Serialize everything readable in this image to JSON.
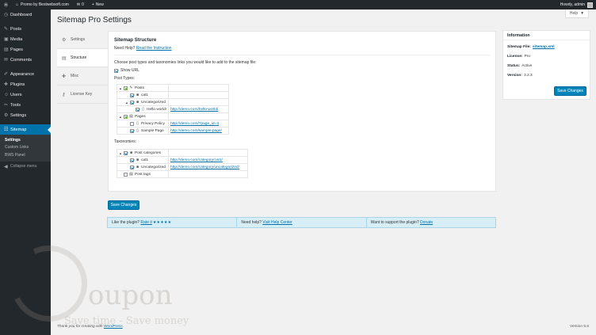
{
  "adminbar": {
    "site_name": "Promo by Bestwebsoft.com",
    "comments_count": "0",
    "new_label": "New",
    "howdy": "Howdy, admin"
  },
  "sidebar": {
    "items": [
      {
        "label": "Dashboard",
        "icon": "dashboard-icon",
        "glyph": "◷"
      },
      {
        "label": "Posts",
        "icon": "pushpin-icon",
        "glyph": "✎"
      },
      {
        "label": "Media",
        "icon": "media-icon",
        "glyph": "▣"
      },
      {
        "label": "Pages",
        "icon": "pages-icon",
        "glyph": "▤"
      },
      {
        "label": "Comments",
        "icon": "comments-icon",
        "glyph": "✉"
      },
      {
        "label": "Appearance",
        "icon": "brush-icon",
        "glyph": "✐"
      },
      {
        "label": "Plugins",
        "icon": "plugin-icon",
        "glyph": "✚"
      },
      {
        "label": "Users",
        "icon": "users-icon",
        "glyph": "☺"
      },
      {
        "label": "Tools",
        "icon": "wrench-icon",
        "glyph": "✂"
      },
      {
        "label": "Settings",
        "icon": "settings-icon",
        "glyph": "⚙"
      },
      {
        "label": "Sitemap",
        "icon": "sitemap-icon",
        "glyph": "☷"
      }
    ],
    "submenu": [
      "Settings",
      "Custom Links",
      "BWS Panel"
    ],
    "collapse_label": "Collapse menu"
  },
  "page": {
    "title": "Sitemap Pro Settings",
    "help_label": "Help"
  },
  "tabs": [
    {
      "label": "Settings",
      "icon": "gear-icon",
      "glyph": "⚙"
    },
    {
      "label": "Structure",
      "icon": "document-icon",
      "glyph": "▤"
    },
    {
      "label": "Misc",
      "icon": "misc-icon",
      "glyph": "✚"
    },
    {
      "label": "License Key",
      "icon": "key-icon",
      "glyph": "⚷"
    }
  ],
  "structure": {
    "title": "Sitemap Structure",
    "need_help": "Need Help?",
    "instruction_link": "Read the Instruction",
    "intro": "Choose post types and taxonomies links you would like to add to the sitemap file:",
    "show_url": "Show URL",
    "post_types_label": "Post Types:",
    "taxonomies_label": "Taxonomies:",
    "post_tree": [
      {
        "label": "Posts",
        "level": 0,
        "state": "partial",
        "toggle": "▲",
        "icon": "pushpin-icon",
        "glyph": "✎",
        "url": ""
      },
      {
        "label": "cat1",
        "level": 1,
        "state": "checked",
        "toggle": "",
        "icon": "folder-icon",
        "glyph": "■",
        "url": ""
      },
      {
        "label": "Uncategorized",
        "level": 1,
        "state": "checked",
        "toggle": "▲",
        "icon": "folder-icon",
        "glyph": "■",
        "url": ""
      },
      {
        "label": "Hello world!",
        "level": 2,
        "state": "checked",
        "toggle": "",
        "icon": "file-icon",
        "glyph": "▯",
        "url": "http://demo.com/hello-world/"
      },
      {
        "label": "Pages",
        "level": 0,
        "state": "partial",
        "toggle": "▲",
        "icon": "pages-icon",
        "glyph": "▤",
        "url": ""
      },
      {
        "label": "Privacy Policy",
        "level": 1,
        "state": "unchecked",
        "toggle": "",
        "icon": "file-icon",
        "glyph": "▯",
        "url": "http://demo.com/?page_id=3"
      },
      {
        "label": "Sample Page",
        "level": 1,
        "state": "checked",
        "toggle": "",
        "icon": "file-icon",
        "glyph": "▯",
        "url": "http://demo.com/sample-page/"
      }
    ],
    "tax_tree": [
      {
        "label": "Post categories",
        "level": 0,
        "state": "checked",
        "toggle": "▲",
        "icon": "folder-icon",
        "glyph": "■",
        "url": ""
      },
      {
        "label": "cat1",
        "level": 1,
        "state": "checked",
        "toggle": "",
        "icon": "folder-icon",
        "glyph": "■",
        "url": "http://demo.com/category/cat1/"
      },
      {
        "label": "Uncategorized",
        "level": 1,
        "state": "checked",
        "toggle": "",
        "icon": "folder-icon",
        "glyph": "■",
        "url": "http://demo.com/category/uncategorized/"
      },
      {
        "label": "Post tags",
        "level": 0,
        "state": "unchecked",
        "toggle": "",
        "icon": "tags-icon",
        "glyph": "▤",
        "url": ""
      }
    ],
    "save_label": "Save Changes"
  },
  "footer_bar": {
    "like_text": "Like the plugin?",
    "rate_link": "Rate it",
    "stars": "★★★★★",
    "help_text": "Need help?",
    "help_link": "Visit Help Center",
    "support_text": "Want to support the plugin?",
    "donate_link": "Donate"
  },
  "info": {
    "title": "Information",
    "file_label": "Sitemap File:",
    "file_link": "sitemap.xml",
    "license_label": "License:",
    "license_value": "Pro",
    "status_label": "Status:",
    "status_value": "Active",
    "version_label": "Version:",
    "version_value": "3.2.3",
    "save_label": "Save Changes"
  },
  "watermark": {
    "word": "oupon",
    "tagline": "Save time - Save money"
  },
  "footer": {
    "thanks": "Thank you for creating with",
    "wp_link": "WordPress",
    "version": "Version 5.6"
  },
  "colors": {
    "accent": "#0073aa",
    "primary_button": "#0085ba",
    "sidebar_bg": "#23282d"
  }
}
